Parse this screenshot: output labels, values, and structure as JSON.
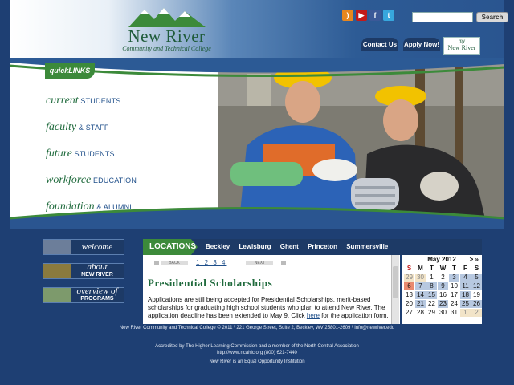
{
  "header": {
    "logo_name": "New River",
    "logo_sub": "Community and Technical College",
    "social": [
      "rss-icon",
      "youtube-icon",
      "facebook-icon",
      "twitter-icon"
    ],
    "search_placeholder": "",
    "search_label": "Search",
    "contact_label": "Contact Us",
    "apply_label": "Apply Now!",
    "my_label": "my",
    "my_name": "New River"
  },
  "quicklinks": {
    "tab_label": "quickLINKS",
    "items": [
      {
        "em": "current",
        "rest": " STUDENTS"
      },
      {
        "em": "faculty",
        "rest": " & STAFF"
      },
      {
        "em": "future",
        "rest": " STUDENTS"
      },
      {
        "em": "workforce",
        "rest": " EDUCATION"
      },
      {
        "em": "foundation",
        "rest": " & ALUMNI"
      }
    ]
  },
  "side_buttons": {
    "welcome": "welcome",
    "about": "about",
    "about_sub": "NEW RIVER",
    "overview": "overview of",
    "overview_sub": "PROGRAMS"
  },
  "locations": {
    "tab_label": "LOCATIONS",
    "links": [
      "Beckley",
      "Lewisburg",
      "Ghent",
      "Princeton",
      "Summersville"
    ]
  },
  "content": {
    "back_label": "BACK",
    "pages": "1 2 3 4",
    "next_label": "NEXT",
    "title": "Presidential Scholarships",
    "body_pre": "Applications are still  being accepted for Presidential Scholarships, merit-based scholarships for graduating high school students who plan to attend New River.  The application deadline has been extended to May 9.  Click ",
    "body_link": "here",
    "body_post": " for the application form."
  },
  "calendar": {
    "month": "May 2012",
    "nav": "> »",
    "dow": [
      "S",
      "M",
      "T",
      "W",
      "T",
      "F",
      "S"
    ],
    "weeks": [
      [
        "29",
        "30",
        "1",
        "2",
        "3",
        "4",
        "5"
      ],
      [
        "6",
        "7",
        "8",
        "9",
        "10",
        "11",
        "12"
      ],
      [
        "13",
        "14",
        "15",
        "16",
        "17",
        "18",
        "19"
      ],
      [
        "20",
        "21",
        "22",
        "23",
        "24",
        "25",
        "26"
      ],
      [
        "27",
        "28",
        "29",
        "30",
        "31",
        "1",
        "2"
      ]
    ]
  },
  "footer": {
    "address": "New River Community and Technical College © 2011 \\ 221 George Street, Suite 2, Beckley, WV 25801-2609 \\ info@newriver.edu",
    "accredited": "Accredited by The Higher Learning Commission and a member of the North Central Association",
    "accredited_2": "http://www.ncahlc.org (800) 621-7440",
    "equal": "New River is an Equal Opportunity Institution"
  },
  "colors": {
    "navy": "#1d3a66",
    "green": "#3c8a3a",
    "background": "#1e3f73"
  }
}
